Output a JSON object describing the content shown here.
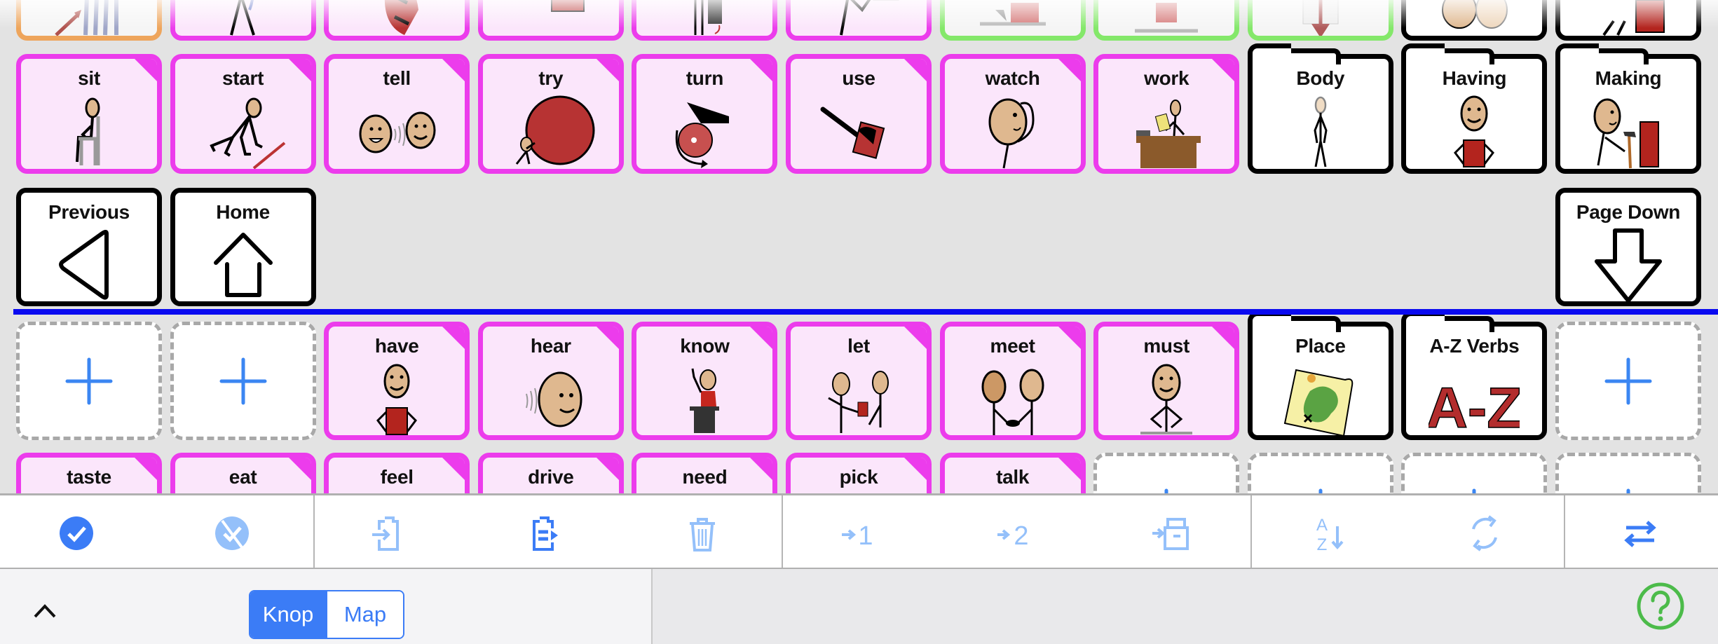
{
  "colors": {
    "verb_border": "#ec3cec",
    "verb_fill": "#fbe6fb",
    "accent_blue": "#3b7cf6",
    "accent_blue_light": "#94c0fa",
    "divider_blue": "#0a0af0",
    "help_green": "#4cbb4a",
    "orange_border": "#eea55c",
    "green_border": "#84e86a"
  },
  "grid": {
    "row_top_partial": [
      {
        "style": "orange",
        "icon": "people-move-icon"
      },
      {
        "style": "verb",
        "icon": "person-phone-icon"
      },
      {
        "style": "verb",
        "icon": "person-ball-icon"
      },
      {
        "style": "verb",
        "icon": "dotted-box-icon"
      },
      {
        "style": "verb",
        "icon": "person-door-icon"
      },
      {
        "style": "verb",
        "icon": "person-picture-icon"
      },
      {
        "style": "green",
        "icon": "put-box-icon"
      },
      {
        "style": "green",
        "icon": "box-on-shelf-icon"
      },
      {
        "style": "green",
        "icon": "box-down-arrow-icon"
      },
      {
        "style": "black",
        "icon": "faces-icon"
      },
      {
        "style": "black",
        "icon": "person-box-icon"
      }
    ],
    "row_verbs": [
      {
        "label": "sit",
        "style": "verb",
        "icon": "sit-icon"
      },
      {
        "label": "start",
        "style": "verb",
        "icon": "start-icon"
      },
      {
        "label": "tell",
        "style": "verb",
        "icon": "tell-icon"
      },
      {
        "label": "try",
        "style": "verb",
        "icon": "try-icon"
      },
      {
        "label": "turn",
        "style": "verb",
        "icon": "turn-icon"
      },
      {
        "label": "use",
        "style": "verb",
        "icon": "use-icon"
      },
      {
        "label": "watch",
        "style": "verb",
        "icon": "watch-icon"
      },
      {
        "label": "work",
        "style": "verb",
        "icon": "work-icon"
      },
      {
        "label": "Body",
        "style": "folder",
        "icon": "body-icon"
      },
      {
        "label": "Having",
        "style": "folder",
        "icon": "having-icon"
      },
      {
        "label": "Making",
        "style": "folder",
        "icon": "making-icon"
      }
    ],
    "row_nav": [
      {
        "label": "Previous",
        "icon": "previous-arrow-icon",
        "col": 0
      },
      {
        "label": "Home",
        "icon": "home-icon",
        "col": 1
      },
      {
        "label": "Page Down",
        "icon": "page-down-arrow-icon",
        "col": 10
      }
    ],
    "row_second_page": [
      {
        "label": "",
        "style": "empty",
        "icon": "plus-icon"
      },
      {
        "label": "",
        "style": "empty",
        "icon": "plus-icon"
      },
      {
        "label": "have",
        "style": "verb",
        "icon": "have-icon"
      },
      {
        "label": "hear",
        "style": "verb",
        "icon": "hear-icon"
      },
      {
        "label": "know",
        "style": "verb",
        "icon": "know-icon"
      },
      {
        "label": "let",
        "style": "verb",
        "icon": "let-icon"
      },
      {
        "label": "meet",
        "style": "verb",
        "icon": "meet-icon"
      },
      {
        "label": "must",
        "style": "verb",
        "icon": "must-icon"
      },
      {
        "label": "Place",
        "style": "folder",
        "icon": "map-icon"
      },
      {
        "label": "A-Z Verbs",
        "style": "folder",
        "icon": "a-z-icon"
      },
      {
        "label": "",
        "style": "empty",
        "icon": "plus-icon"
      }
    ],
    "row_bottom_partial": [
      {
        "label": "taste",
        "style": "verb"
      },
      {
        "label": "eat",
        "style": "verb"
      },
      {
        "label": "feel",
        "style": "verb"
      },
      {
        "label": "drive",
        "style": "verb"
      },
      {
        "label": "need",
        "style": "verb"
      },
      {
        "label": "pick",
        "style": "verb"
      },
      {
        "label": "talk",
        "style": "verb"
      },
      {
        "label": "",
        "style": "empty"
      },
      {
        "label": "",
        "style": "empty"
      },
      {
        "label": "",
        "style": "empty"
      },
      {
        "label": "",
        "style": "empty"
      }
    ],
    "az_text": "A-Z"
  },
  "toolbar": {
    "buttons": [
      {
        "name": "select-all-button",
        "icon": "check-circle-icon",
        "enabled": true
      },
      {
        "name": "deselect-button",
        "icon": "uncheck-circle-icon",
        "enabled": false
      },
      {
        "name": "import-button",
        "icon": "clipboard-import-icon",
        "enabled": false
      },
      {
        "name": "paste-button",
        "icon": "clipboard-paste-icon",
        "enabled": true
      },
      {
        "name": "delete-button",
        "icon": "trash-icon",
        "enabled": false
      },
      {
        "name": "move-to-1-button",
        "icon": "arrow-1-icon",
        "enabled": false,
        "text": "1"
      },
      {
        "name": "move-to-2-button",
        "icon": "arrow-2-icon",
        "enabled": false,
        "text": "2"
      },
      {
        "name": "move-to-archive-button",
        "icon": "arrow-archive-icon",
        "enabled": false
      },
      {
        "name": "sort-button",
        "icon": "sort-az-icon",
        "enabled": false,
        "text_top": "A",
        "text_bottom": "Z"
      },
      {
        "name": "refresh-button",
        "icon": "refresh-icon",
        "enabled": false
      },
      {
        "name": "swap-button",
        "icon": "swap-arrows-icon",
        "enabled": true
      }
    ]
  },
  "bottombar": {
    "segment": {
      "options": [
        "Knop",
        "Map"
      ],
      "selected": "Knop"
    },
    "help_label": "?"
  }
}
